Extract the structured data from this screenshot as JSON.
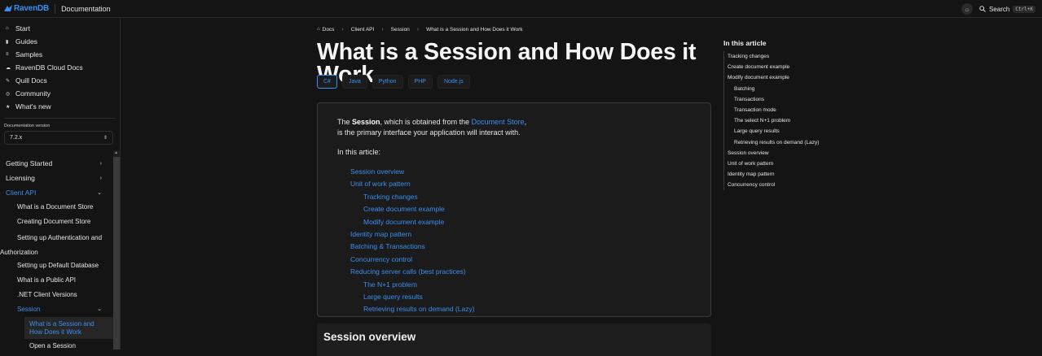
{
  "topbar": {
    "logo": "RavenDB",
    "title": "Documentation",
    "search_label": "Search",
    "search_shortcut": "Ctrl+K"
  },
  "sidebar": {
    "main_nav": [
      {
        "label": "Start",
        "icon": "home-icon"
      },
      {
        "label": "Guides",
        "icon": "book-icon"
      },
      {
        "label": "Samples",
        "icon": "samples-icon"
      },
      {
        "label": "RavenDB Cloud Docs",
        "icon": "cloud-icon"
      },
      {
        "label": "Quill Docs",
        "icon": "quill-icon"
      },
      {
        "label": "Community",
        "icon": "globe-icon"
      },
      {
        "label": "What's new",
        "icon": "star-icon"
      }
    ],
    "version_label": "Documentation version",
    "version_value": "7.2.x",
    "tree": {
      "getting_started": "Getting Started",
      "licensing": "Licensing",
      "client_api": "Client API",
      "client_api_items": [
        "What is a Document Store",
        "Creating Document Store",
        "Setting up Authentication and Authorization",
        "Setting up Default Database",
        "What is a Public API",
        ".NET Client Versions"
      ],
      "session": "Session",
      "session_items": [
        "What is a Session and How Does it Work",
        "Open a Session"
      ]
    }
  },
  "breadcrumb": {
    "docs": "Docs",
    "client_api": "Client API",
    "session": "Session",
    "current": "What is a Session and How Does it Work"
  },
  "page": {
    "title": "What is a Session and How Does it Work",
    "lang_tabs": [
      "C#",
      "Java",
      "Python",
      "PHP",
      "Node.js"
    ],
    "intro": {
      "the": "The ",
      "session_word": "Session",
      "obtained": ", which is obtained from the ",
      "doc_store": "Document Store",
      "comma": ",",
      "line2": "is the primary interface your application will interact with.",
      "in_this_article": "In this article:"
    },
    "toc": [
      {
        "label": "Session overview",
        "level": 1
      },
      {
        "label": "Unit of work pattern",
        "level": 1
      },
      {
        "label": "Tracking changes",
        "level": 2
      },
      {
        "label": "Create document example",
        "level": 2
      },
      {
        "label": "Modify document example",
        "level": 2
      },
      {
        "label": "Identity map pattern",
        "level": 1
      },
      {
        "label": "Batching & Transactions",
        "level": 1
      },
      {
        "label": "Concurrency control",
        "level": 1
      },
      {
        "label": "Reducing server calls (best practices)",
        "level": 1
      },
      {
        "label": "The N+1 problem",
        "level": 2
      },
      {
        "label": "Large query results",
        "level": 2
      },
      {
        "label": "Retrieving results on demand (Lazy)",
        "level": 2
      }
    ],
    "section_heading": "Session overview"
  },
  "article_toc": {
    "heading": "In this article",
    "items": [
      {
        "label": "Tracking changes",
        "sub": false
      },
      {
        "label": "Create document example",
        "sub": false
      },
      {
        "label": "Modify document example",
        "sub": false
      },
      {
        "label": "Batching",
        "sub": true
      },
      {
        "label": "Transactions",
        "sub": true
      },
      {
        "label": "Transaction mode",
        "sub": true
      },
      {
        "label": "The select N+1 problem",
        "sub": true
      },
      {
        "label": "Large query results",
        "sub": true
      },
      {
        "label": "Retrieving results on demand (Lazy)",
        "sub": true
      },
      {
        "label": "Session overview",
        "sub": false
      },
      {
        "label": "Unit of work pattern",
        "sub": false
      },
      {
        "label": "Identity map pattern",
        "sub": false
      },
      {
        "label": "Concurrency control",
        "sub": false
      }
    ]
  },
  "colors": {
    "accent": "#3b8ff0",
    "background": "#141414",
    "panel": "#1b1b1b"
  }
}
